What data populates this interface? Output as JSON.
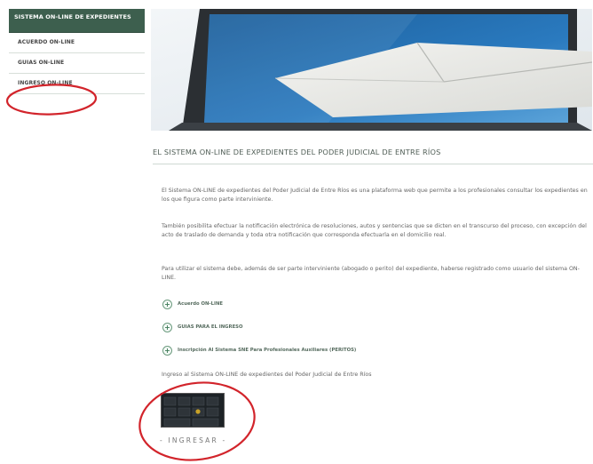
{
  "sidebar": {
    "header": "SISTEMA ON-LINE DE EXPEDIENTES",
    "items": [
      {
        "label": "ACUERDO ON-LINE"
      },
      {
        "label": "GUIAS ON-LINE"
      },
      {
        "label": "INGRESO ON-LINE"
      }
    ]
  },
  "main": {
    "title": "EL SISTEMA ON-LINE DE EXPEDIENTES DEL PODER JUDICIAL DE ENTRE RÍOS",
    "paragraphs": [
      "El Sistema ON-LINE de expedientes del Poder Judicial de Entre Ríos es una plataforma web que permite a los profesionales consultar los expedientes en los que figura como parte interviniente.",
      "También posibilita efectuar la notificación electrónica de resoluciones, autos y sentencias que se dicten en el transcurso del proceso, con excepción del acto de traslado de demanda y toda otra notificación que corresponda efectuarla en el domicilio real.",
      "Para utilizar el sistema debe, además de ser parte interviniente (abogado o perito) del expediente, haberse registrado como usuario del sistema ON-LINE."
    ],
    "links": [
      {
        "icon": "plus-circle-icon",
        "label": "Acuerdo ON-LINE"
      },
      {
        "icon": "plus-circle-icon",
        "label": "GUIAS PARA EL INGRESO"
      },
      {
        "icon": "plus-circle-icon",
        "label": "Inscripción Al Sistema SNE Para Profesionales Auxiliares (PERITOS)"
      }
    ],
    "ingreso_text": "Ingreso al Sistema ON-LINE de expedientes del Poder Judicial de Entre Ríos",
    "ingresar_label": "- INGRESAR -"
  },
  "colors": {
    "sidebar_header_bg": "#3d5f4e",
    "annotation_circle": "#d2242b",
    "link_icon": "#3e7a58"
  }
}
